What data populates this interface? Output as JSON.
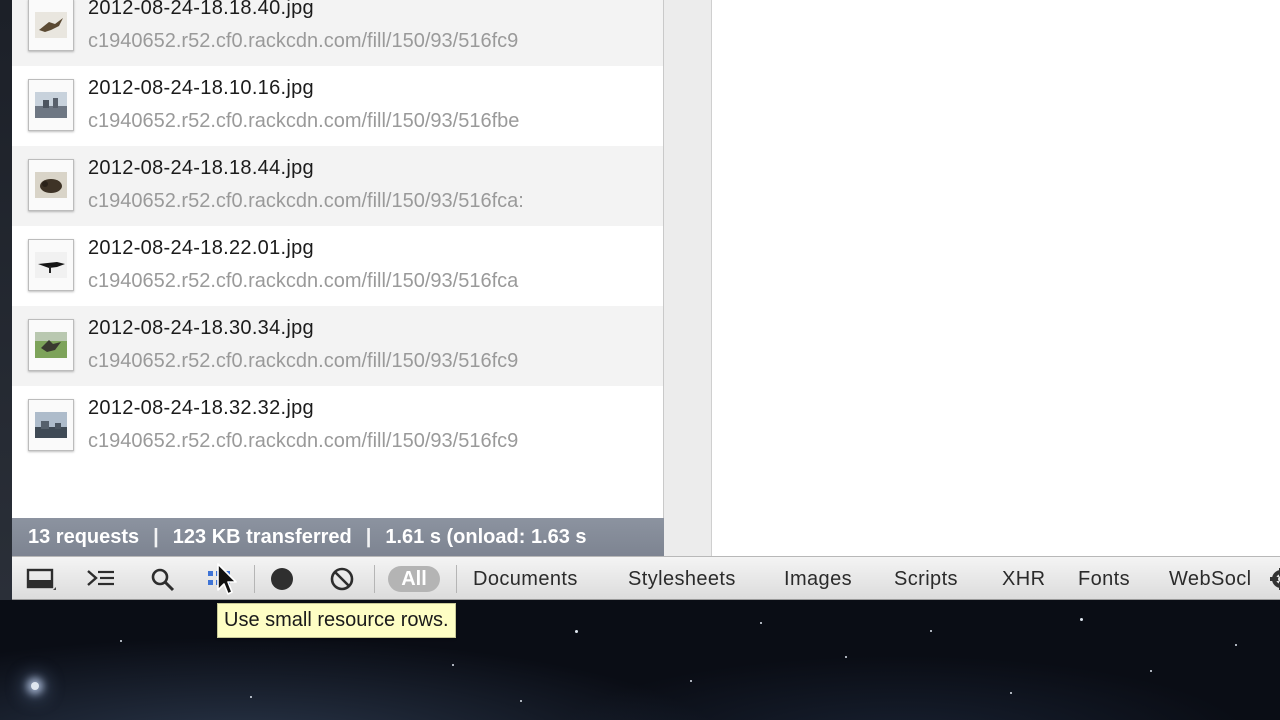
{
  "resources": [
    {
      "name": "2012-08-24-18.18.40.jpg",
      "url": "c1940652.r52.cf0.rackcdn.com/fill/150/93/516fc9"
    },
    {
      "name": "2012-08-24-18.10.16.jpg",
      "url": "c1940652.r52.cf0.rackcdn.com/fill/150/93/516fbe"
    },
    {
      "name": "2012-08-24-18.18.44.jpg",
      "url": "c1940652.r52.cf0.rackcdn.com/fill/150/93/516fca:"
    },
    {
      "name": "2012-08-24-18.22.01.jpg",
      "url": "c1940652.r52.cf0.rackcdn.com/fill/150/93/516fca"
    },
    {
      "name": "2012-08-24-18.30.34.jpg",
      "url": "c1940652.r52.cf0.rackcdn.com/fill/150/93/516fc9"
    },
    {
      "name": "2012-08-24-18.32.32.jpg",
      "url": "c1940652.r52.cf0.rackcdn.com/fill/150/93/516fc9"
    }
  ],
  "summary": {
    "requests": "13 requests",
    "transferred": "123 KB transferred",
    "timing": "1.61 s (onload: 1.63 s"
  },
  "toolbar": {
    "icons": [
      "dock-icon",
      "console-icon",
      "search-icon",
      "small-rows-icon",
      "record-icon",
      "clear-icon",
      "gear-icon"
    ],
    "filters": {
      "all": "All",
      "documents": "Documents",
      "stylesheets": "Stylesheets",
      "images": "Images",
      "scripts": "Scripts",
      "xhr": "XHR",
      "fonts": "Fonts",
      "websockets": "WebSocl"
    }
  },
  "tooltip": "Use small resource rows."
}
